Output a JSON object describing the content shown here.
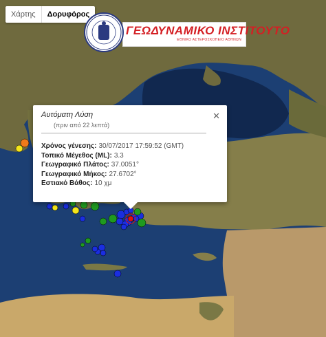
{
  "map_type": {
    "map_label": "Χάρτης",
    "satellite_label": "Δορυφόρος"
  },
  "logo": {
    "title": "ΓΕΩΔΥΝΑΜΙΚΟ ΙΝΣΤΙΤΟΥΤΟ",
    "subtitle": "ΕΘΝΙΚΟ ΑΣΤΕΡΟΣΚΟΠΕΙΟ ΑΘΗΝΩΝ",
    "seal_text": "ΕΘΝΙΚΟΝ ΑΣΤΕΡΟΣΚΟΠΕΙΟΝ ΑΘΗΝΩΝ · ΓΕΩΔΥΝΑΜΙΚΟΝ ΙΝΣΤΙΤΟΥΤΟΝ"
  },
  "popup": {
    "title": "Αυτόματη Λύση",
    "subtitle": "(πριν από 22 λεπτά)",
    "close": "✕",
    "rows": [
      {
        "label": "Χρόνος γένεσης:",
        "value": "30/07/2017",
        "extra": "17:59:52 (GMT)"
      },
      {
        "label": "Τοπικό Μέγεθος (ML):",
        "value": "3.3",
        "extra": ""
      },
      {
        "label": "Γεωγραφικό Πλάτος:",
        "value": "37.0051°",
        "extra": ""
      },
      {
        "label": "Γεωγραφικό Μήκος:",
        "value": "27.6702°",
        "extra": ""
      },
      {
        "label": "Εστιακό Βάθος:",
        "value": "10 χμ",
        "extra": ""
      }
    ]
  },
  "colors": {
    "sea": "#1c3f73",
    "land": "#6b6a3e",
    "desert": "#c9a86a",
    "marker_blue": "#1a2ee0",
    "marker_green": "#1f9a1f",
    "marker_yellow": "#f5e61a",
    "marker_orange": "#f07a1a",
    "marker_red": "#e01010"
  },
  "markers": [
    {
      "type": "blue"
    },
    {
      "type": "blue"
    },
    {
      "type": "blue"
    },
    {
      "type": "blue"
    },
    {
      "type": "blue"
    },
    {
      "type": "blue"
    },
    {
      "type": "blue"
    },
    {
      "type": "blue"
    },
    {
      "type": "blue"
    },
    {
      "type": "blue"
    },
    {
      "type": "blue"
    },
    {
      "type": "blue"
    },
    {
      "type": "blue"
    },
    {
      "type": "blue"
    },
    {
      "type": "blue"
    },
    {
      "type": "blue"
    },
    {
      "type": "blue"
    },
    {
      "type": "blue"
    },
    {
      "type": "green"
    },
    {
      "type": "green"
    },
    {
      "type": "green"
    },
    {
      "type": "green"
    },
    {
      "type": "green"
    },
    {
      "type": "green"
    },
    {
      "type": "green"
    },
    {
      "type": "green"
    },
    {
      "type": "green"
    },
    {
      "type": "yellow"
    },
    {
      "type": "yellow"
    },
    {
      "type": "yellow"
    },
    {
      "type": "orange"
    },
    {
      "type": "red"
    }
  ]
}
